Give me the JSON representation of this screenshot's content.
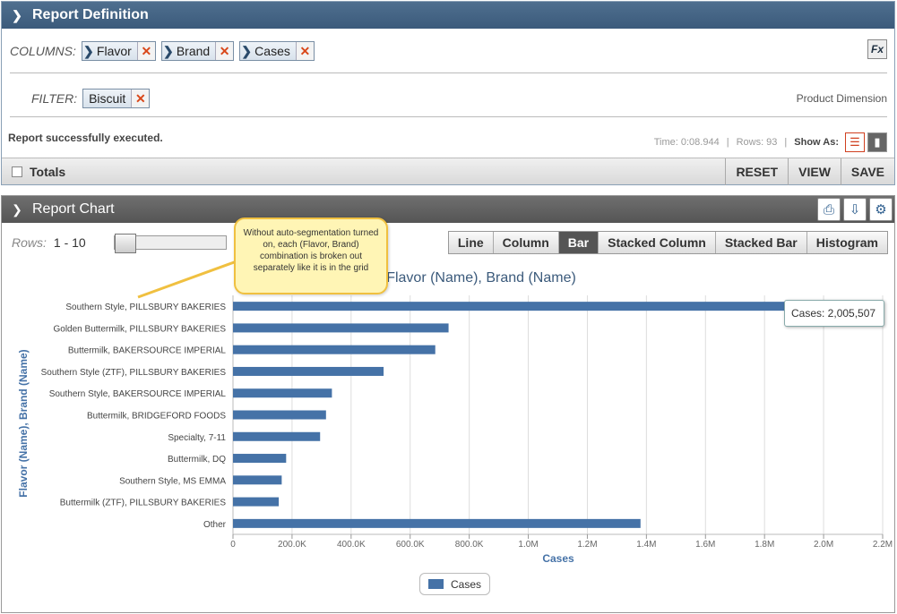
{
  "definition": {
    "title": "Report Definition",
    "columns_label": "COLUMNS:",
    "columns": [
      "Flavor",
      "Brand",
      "Cases"
    ],
    "filter_label": "FILTER:",
    "filters": [
      "Biscuit"
    ],
    "dimension": "Product Dimension",
    "status": "Report successfully executed.",
    "time": "Time: 0:08.944",
    "rows": "Rows: 93",
    "show_as": "Show As:",
    "totals": "Totals",
    "reset": "RESET",
    "view": "VIEW",
    "save": "SAVE",
    "fx": "Fx"
  },
  "chart_panel": {
    "title": "Report Chart",
    "rows_label": "Rows:",
    "rows_value": "1 - 10",
    "tabs": [
      "Line",
      "Column",
      "Bar",
      "Stacked Column",
      "Stacked Bar",
      "Histogram"
    ],
    "active_tab": "Bar",
    "callout": "Without auto-segmentation turned on, each (Flavor, Brand) combination is broken out separately like it is in the grid",
    "tooltip": "Cases: 2,005,507",
    "legend": "Cases"
  },
  "chart_data": {
    "type": "bar",
    "orientation": "horizontal",
    "title": "Flavor (Name), Brand (Name)",
    "xlabel": "Cases",
    "ylabel": "Flavor (Name), Brand (Name)",
    "categories": [
      "Southern Style, PILLSBURY BAKERIES",
      "Golden Buttermilk, PILLSBURY BAKERIES",
      "Buttermilk, BAKERSOURCE IMPERIAL",
      "Southern Style (ZTF), PILLSBURY BAKERIES",
      "Southern Style, BAKERSOURCE IMPERIAL",
      "Buttermilk, BRIDGEFORD FOODS",
      "Specialty, 7-11",
      "Buttermilk, DQ",
      "Southern Style, MS EMMA",
      "Buttermilk (ZTF), PILLSBURY BAKERIES",
      "Other"
    ],
    "series": [
      {
        "name": "Cases",
        "values": [
          2005507,
          730000,
          685000,
          510000,
          335000,
          315000,
          295000,
          180000,
          165000,
          155000,
          1380000
        ]
      }
    ],
    "xlim": [
      0,
      2200000
    ],
    "xticks": [
      "0",
      "200.0K",
      "400.0K",
      "600.0K",
      "800.0K",
      "1.0M",
      "1.2M",
      "1.4M",
      "1.6M",
      "1.8M",
      "2.0M",
      "2.2M"
    ],
    "color": "#4572a7",
    "grid": true,
    "legend_position": "bottom"
  }
}
